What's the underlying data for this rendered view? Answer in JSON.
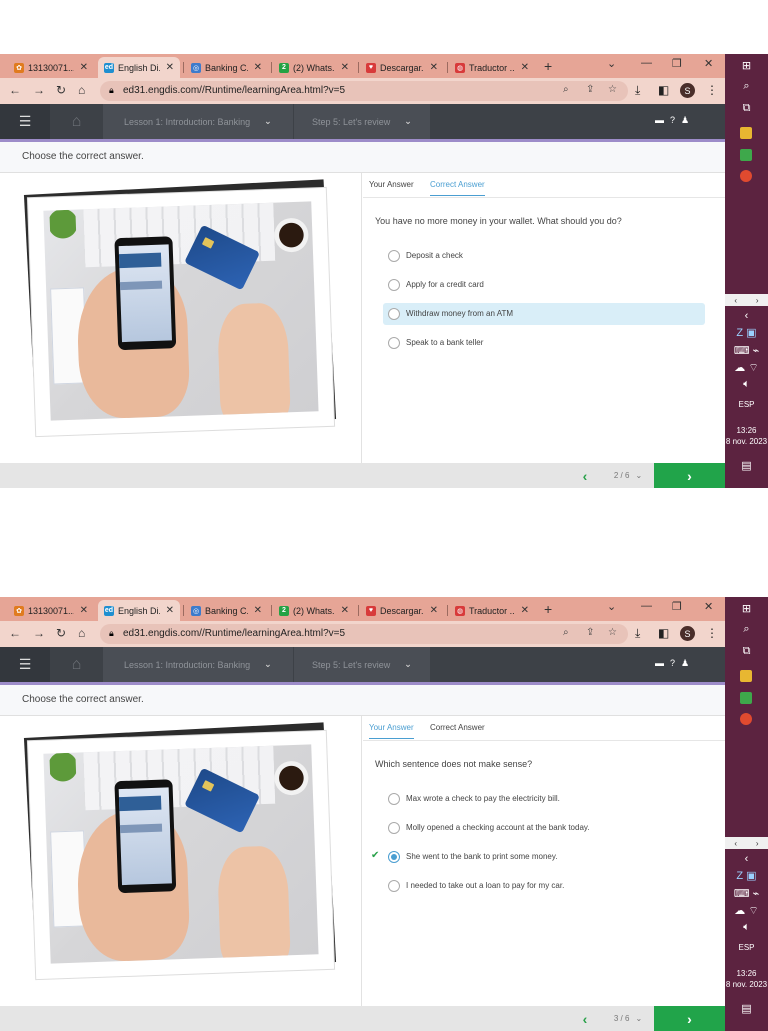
{
  "browser": {
    "tabs": [
      {
        "title": "13130071...",
        "color": "#e07b1f",
        "glyph": "✿"
      },
      {
        "title": "English Di...",
        "color": "#1f8fd0",
        "glyph": "ed"
      },
      {
        "title": "Banking C...",
        "color": "#3d7bcc",
        "glyph": "◎"
      },
      {
        "title": "(2) Whats...",
        "color": "#25a244",
        "glyph": "2"
      },
      {
        "title": "Descargar...",
        "color": "#d83a3a",
        "glyph": "♥"
      },
      {
        "title": "Traductor ...",
        "color": "#d83a3a",
        "glyph": "◍"
      }
    ],
    "url": "ed31.engdis.com//Runtime/learningArea.html?v=5",
    "profile_initial": "S"
  },
  "app": {
    "lesson_label": "Lesson 1: Introduction: Banking",
    "step_label": "Step 5: Let's review",
    "instruction": "Choose the correct answer.",
    "tab_your_answer": "Your Answer",
    "tab_correct_answer": "Correct Answer",
    "next_arrow": "›",
    "prev_arrow": "‹"
  },
  "screens": [
    {
      "selected_tab": "correct",
      "question": "You have no more money in your wallet. What should you do?",
      "options": [
        {
          "text": "Deposit a check",
          "highlighted": false,
          "selected": false,
          "checked": false
        },
        {
          "text": "Apply for a credit card",
          "highlighted": false,
          "selected": false,
          "checked": false
        },
        {
          "text": "Withdraw money from an ATM",
          "highlighted": true,
          "selected": false,
          "checked": false
        },
        {
          "text": "Speak to a bank teller",
          "highlighted": false,
          "selected": false,
          "checked": false
        }
      ],
      "page": "2 / 6"
    },
    {
      "selected_tab": "your",
      "question": "Which sentence does not make sense?",
      "options": [
        {
          "text": "Max wrote a check to pay the electricity bill.",
          "highlighted": false,
          "selected": false,
          "checked": false
        },
        {
          "text": "Molly opened a checking account at the bank today.",
          "highlighted": false,
          "selected": false,
          "checked": false
        },
        {
          "text": "She went to the bank to print some money.",
          "highlighted": false,
          "selected": true,
          "checked": true
        },
        {
          "text": "I needed to take out a loan to pay for my car.",
          "highlighted": false,
          "selected": false,
          "checked": false
        }
      ],
      "page": "3 / 6"
    }
  ],
  "taskbar": {
    "lang": "ESP",
    "time": "13:26",
    "date": "8 nov. 2023"
  },
  "colors": {
    "accent": "#4a9ed1",
    "next_green": "#21a44a",
    "tabbar": "#e6a596",
    "taskbar": "#5c2340"
  }
}
